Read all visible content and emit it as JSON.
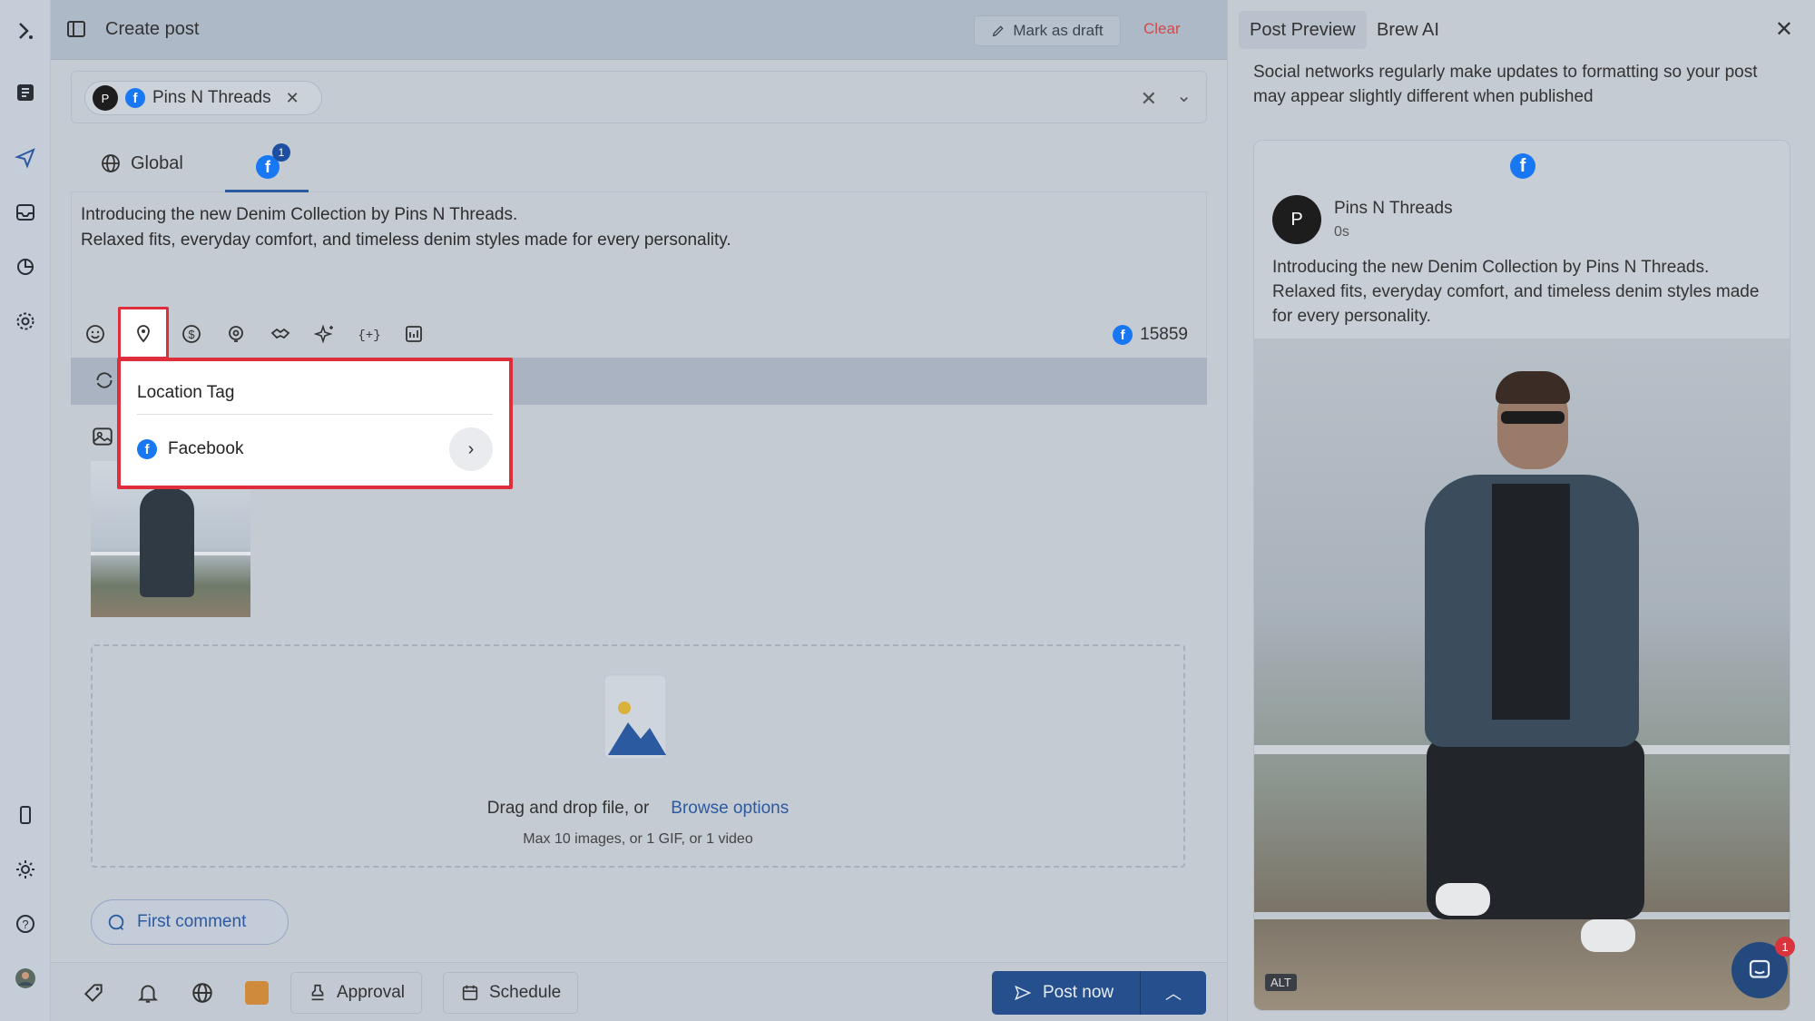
{
  "rail": {
    "icons": [
      "logo-icon",
      "book-icon",
      "send-icon",
      "inbox-icon",
      "analytics-icon",
      "settings-icon",
      "mobile-icon",
      "theme-icon",
      "help-icon",
      "user-avatar"
    ]
  },
  "topbar": {
    "title": "Create post",
    "draft_label": "Mark as draft",
    "clear_label": "Clear"
  },
  "accounts": {
    "selected": "Pins N Threads"
  },
  "tabs": {
    "global_label": "Global",
    "facebook_badge": "1"
  },
  "editor": {
    "line1": "Introducing the new Denim Collection by Pins N Threads.",
    "line2": "Relaxed fits, everyday comfort, and timeless denim styles made for every personality.",
    "char_count": "15859"
  },
  "popup": {
    "title": "Location Tag",
    "option": "Facebook"
  },
  "dropzone": {
    "text": "Drag and drop file, or",
    "link": "Browse options",
    "sub": "Max 10 images, or 1 GIF, or 1 video"
  },
  "first_comment": "First comment",
  "bottombar": {
    "approval": "Approval",
    "schedule": "Schedule",
    "post_now": "Post now"
  },
  "preview": {
    "tab_preview": "Post Preview",
    "tab_ai": "Brew AI",
    "note": "Social networks regularly make updates to formatting so your post may appear slightly different when published",
    "account_name": "Pins N Threads",
    "time": "0s",
    "body": "Introducing the new Denim Collection by Pins N Threads. Relaxed fits, everyday comfort, and timeless denim styles made for every personality.",
    "alt_label": "ALT"
  },
  "chat": {
    "badge": "1"
  },
  "colors": {
    "facebook": "#1877f2",
    "primary": "#264f8e",
    "highlight": "#e02d3c",
    "clear": "#d24a4a"
  }
}
